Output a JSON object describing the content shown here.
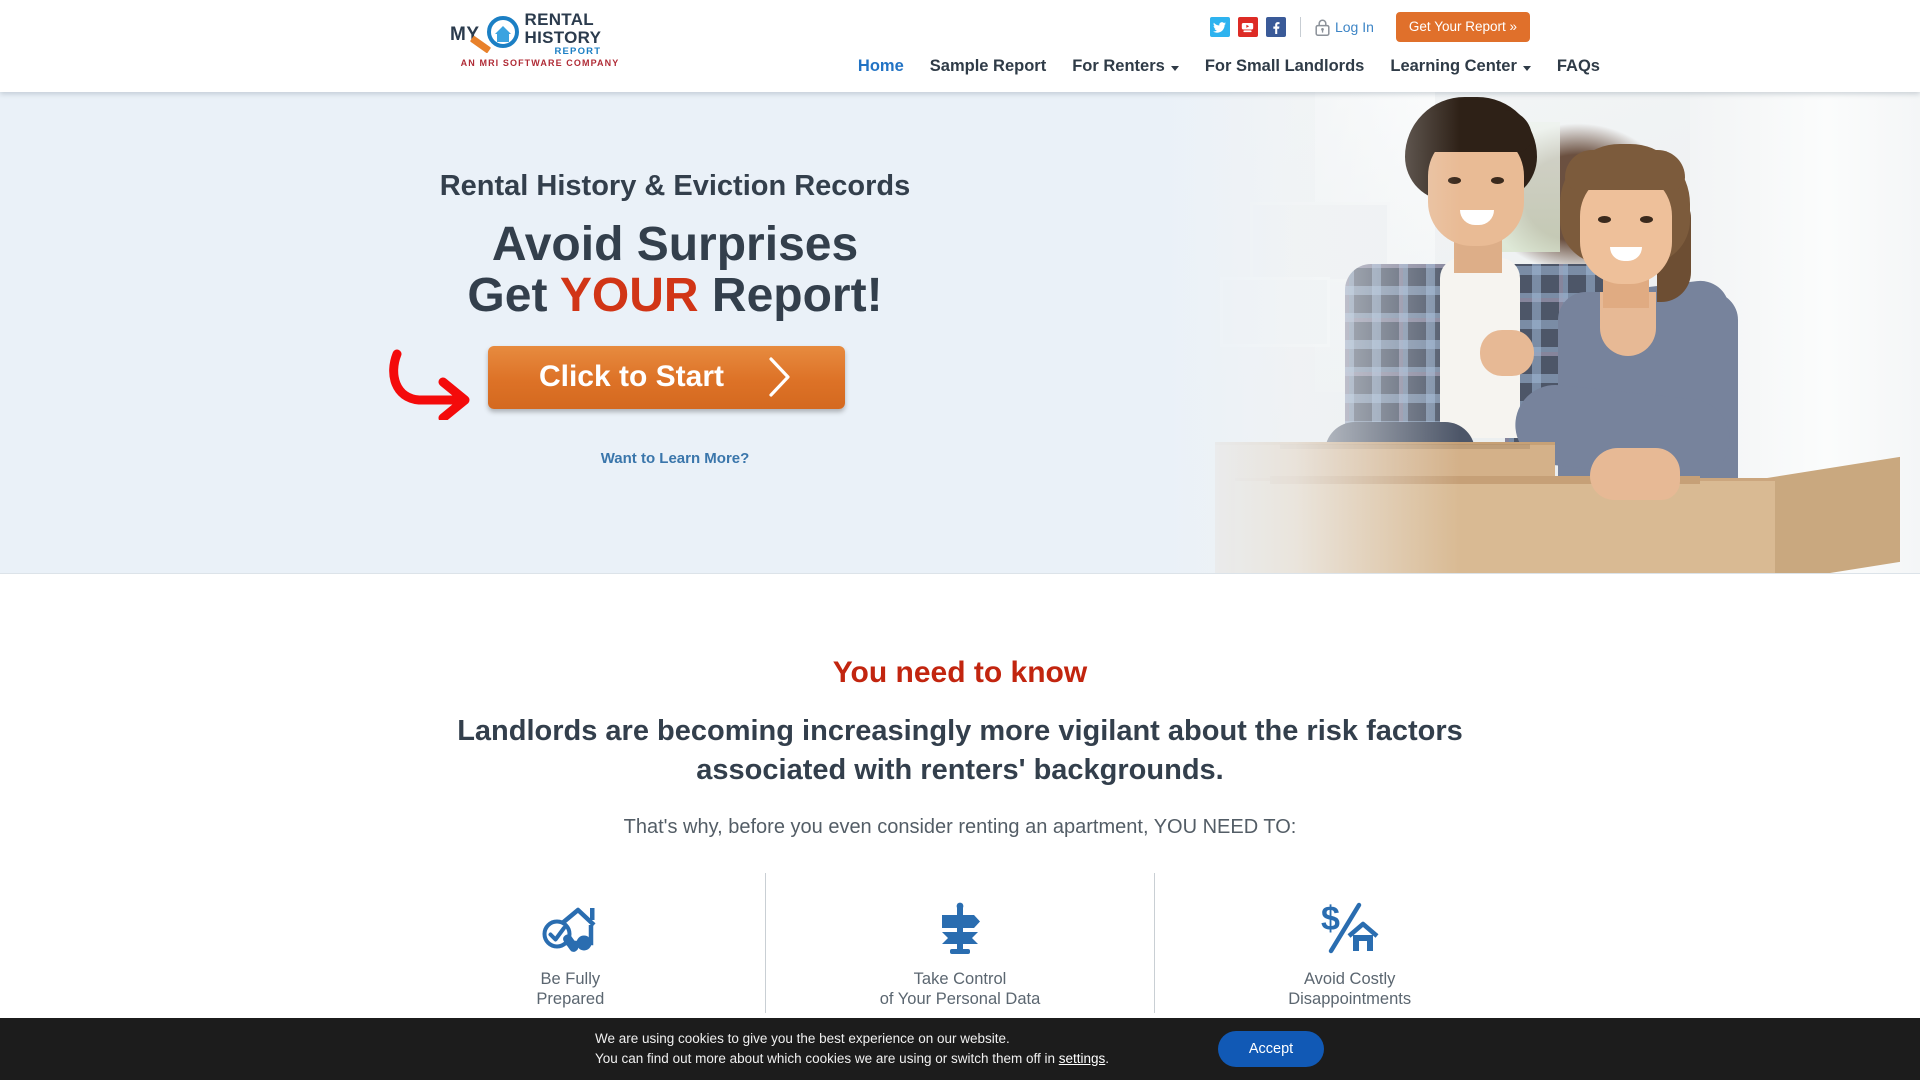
{
  "header": {
    "logo": {
      "my": "MY",
      "rental": "RENTAL",
      "history": "HISTORY",
      "report": "REPORT",
      "tagline": "AN MRI SOFTWARE COMPANY"
    },
    "social": [
      {
        "name": "twitter-icon",
        "label": "Twitter",
        "color": "#2eb3ef"
      },
      {
        "name": "youtube-icon",
        "label": "YouTube",
        "color": "#dd2b25"
      },
      {
        "name": "facebook-icon",
        "label": "Facebook",
        "color": "#3a5a98"
      }
    ],
    "login_label": "Log In",
    "report_button_label": "Get Your Report »",
    "nav": [
      {
        "label": "Home",
        "active": true,
        "caret": false
      },
      {
        "label": "Sample Report",
        "active": false,
        "caret": false
      },
      {
        "label": "For Renters",
        "active": false,
        "caret": true
      },
      {
        "label": "For Small Landlords",
        "active": false,
        "caret": false
      },
      {
        "label": "Learning Center",
        "active": false,
        "caret": true
      },
      {
        "label": "FAQs",
        "active": false,
        "caret": false
      }
    ]
  },
  "hero": {
    "kicker": "Rental History & Eviction Records",
    "headline_line1": "Avoid Surprises",
    "headline_line2_pre": "Get ",
    "headline_line2_em": "YOUR",
    "headline_line2_post": " Report!",
    "cta_label": "Click to Start",
    "learn_more_label": "Want to Learn More?",
    "background_color": "#eaf1f8",
    "cta_color": "#dd7227",
    "accent_red": "#d13516",
    "link_color": "#3a76ab"
  },
  "info": {
    "kicker": "You need to know",
    "headline": "Landlords are becoming increasingly more vigilant about the risk factors associated with renters' backgrounds.",
    "subtext": "That's why, before you even consider renting an apartment, YOU NEED TO:",
    "kicker_color": "#c2250f",
    "icon_color": "#2a6db0",
    "columns": [
      {
        "icon": "house-check-icon",
        "line1": "Be Fully",
        "line2": "Prepared"
      },
      {
        "icon": "signpost-icon",
        "line1": "Take Control",
        "line2": "of Your Personal Data"
      },
      {
        "icon": "dollar-house-icon",
        "line1": "Avoid Costly",
        "line2": "Disappointments"
      }
    ]
  },
  "cookie": {
    "line1": "We are using cookies to give you the best experience on our website.",
    "line2_pre": "You can find out more about which cookies we are using or switch them off in ",
    "settings_label": "settings",
    "line2_post": ".",
    "accept_label": "Accept",
    "accept_color": "#1159b5",
    "background_color": "#1c1c1c"
  }
}
